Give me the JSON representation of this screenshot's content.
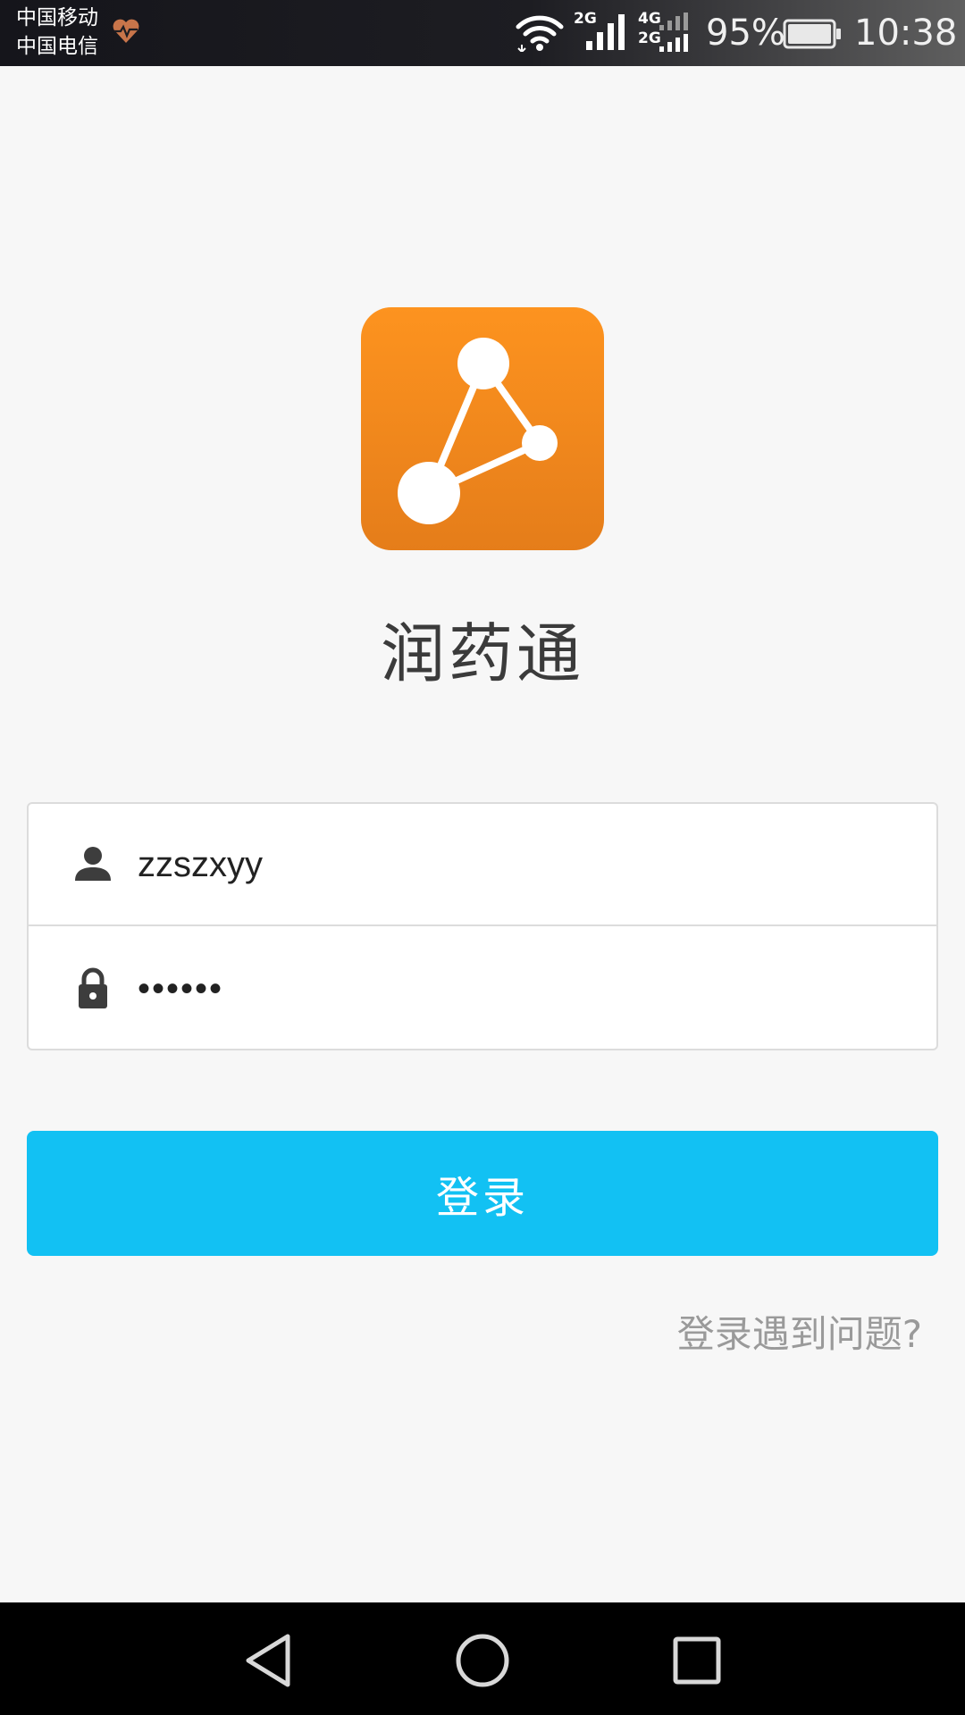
{
  "status_bar": {
    "carrier_1": "中国移动",
    "carrier_2": "中国电信",
    "net_2g_a": "2G",
    "net_4g": "4G",
    "net_2g_b": "2G",
    "battery": "95%",
    "time": "10:38",
    "icons": [
      "heart-monitor-icon",
      "wifi-icon",
      "signal-icon",
      "battery-icon"
    ]
  },
  "app": {
    "name": "润药通",
    "logo_icon": "molecule-logo-icon",
    "logo_color": "#fd931f"
  },
  "login_form": {
    "username_value": "zzszxyy",
    "password_value": "••••••",
    "username_icon": "person-icon",
    "password_icon": "lock-icon"
  },
  "actions": {
    "login_label": "登录",
    "login_color": "#12c1f3",
    "help_label": "登录遇到问题?"
  },
  "nav_bar": {
    "icons": [
      "back-icon",
      "home-icon",
      "recents-icon"
    ]
  }
}
